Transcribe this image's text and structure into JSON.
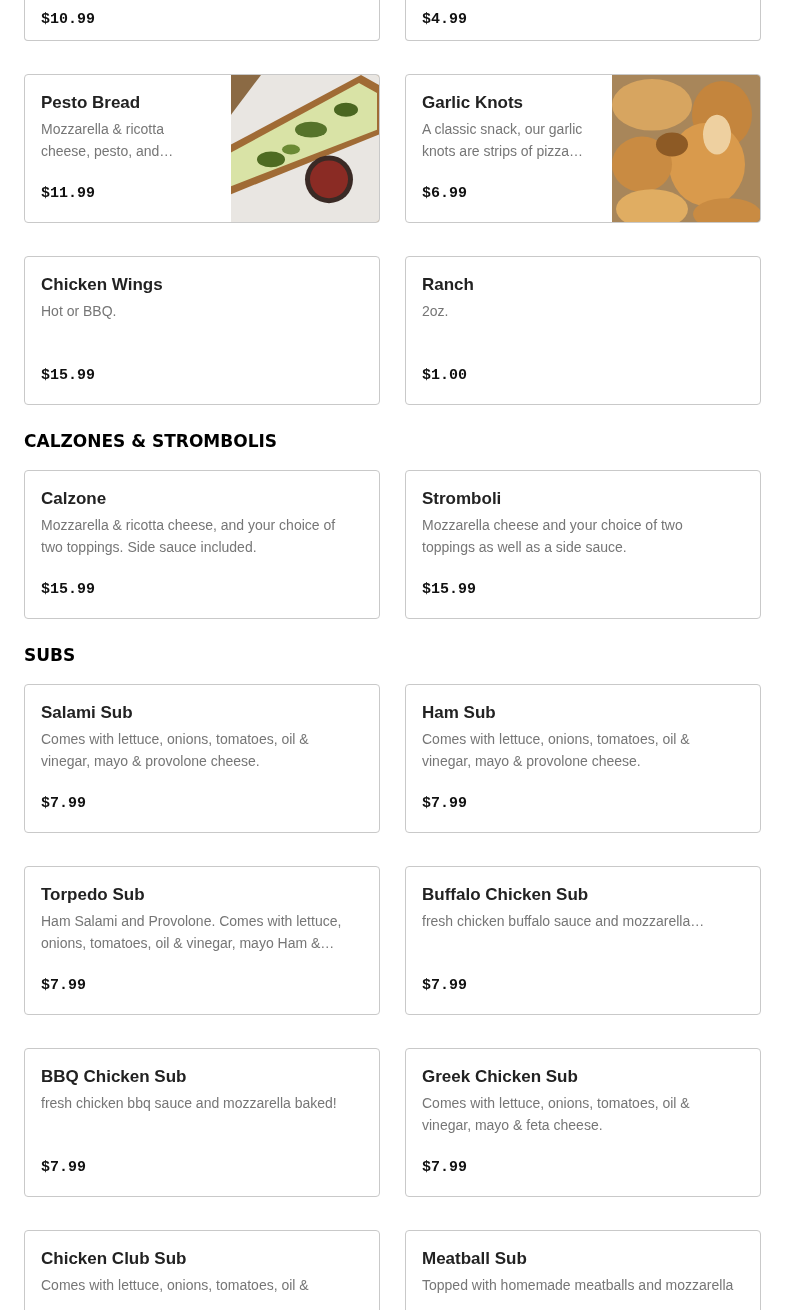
{
  "sections": [
    {
      "items": [
        {
          "price": "$10.99",
          "cut": true
        },
        {
          "price": "$4.99",
          "cut": true
        },
        {
          "name": "Pesto Bread",
          "description": "Mozzarella & ricotta cheese, pesto, and…",
          "price": "$11.99"
        },
        {
          "name": "Garlic Knots",
          "description": "A classic snack, our garlic knots are strips of pizza…",
          "price": "$6.99"
        },
        {
          "name": "Chicken Wings",
          "description": "Hot or BBQ.",
          "price": "$15.99"
        },
        {
          "name": "Ranch",
          "description": "2oz.",
          "price": "$1.00"
        }
      ]
    },
    {
      "heading": "CALZONES & STROMBOLIS",
      "items": [
        {
          "name": "Calzone",
          "description": "Mozzarella & ricotta cheese, and your choice of two toppings. Side sauce included.",
          "price": "$15.99"
        },
        {
          "name": "Stromboli",
          "description": "Mozzarella cheese and your choice of two toppings as well as a side sauce.",
          "price": "$15.99"
        }
      ]
    },
    {
      "heading": "SUBS",
      "items": [
        {
          "name": "Salami Sub",
          "description": "Comes with lettuce, onions, tomatoes, oil & vinegar, mayo & provolone cheese.",
          "price": "$7.99"
        },
        {
          "name": "Ham Sub",
          "description": "Comes with lettuce, onions, tomatoes, oil & vinegar, mayo & provolone cheese.",
          "price": "$7.99"
        },
        {
          "name": "Torpedo Sub",
          "description": "Ham Salami and Provolone. Comes with lettuce, onions, tomatoes, oil & vinegar, mayo Ham &…",
          "price": "$7.99"
        },
        {
          "name": "Buffalo Chicken Sub",
          "description": "fresh chicken buffalo sauce and mozzarella…",
          "price": "$7.99"
        },
        {
          "name": "BBQ Chicken Sub",
          "description": "fresh chicken bbq sauce and mozzarella baked!",
          "price": "$7.99"
        },
        {
          "name": "Greek Chicken Sub",
          "description": "Comes with lettuce, onions, tomatoes, oil & vinegar, mayo & feta cheese.",
          "price": "$7.99"
        },
        {
          "name": "Chicken Club Sub",
          "description": "Comes with lettuce, onions, tomatoes, oil &"
        },
        {
          "name": "Meatball Sub",
          "description": "Topped with homemade meatballs and mozzarella"
        }
      ]
    }
  ]
}
